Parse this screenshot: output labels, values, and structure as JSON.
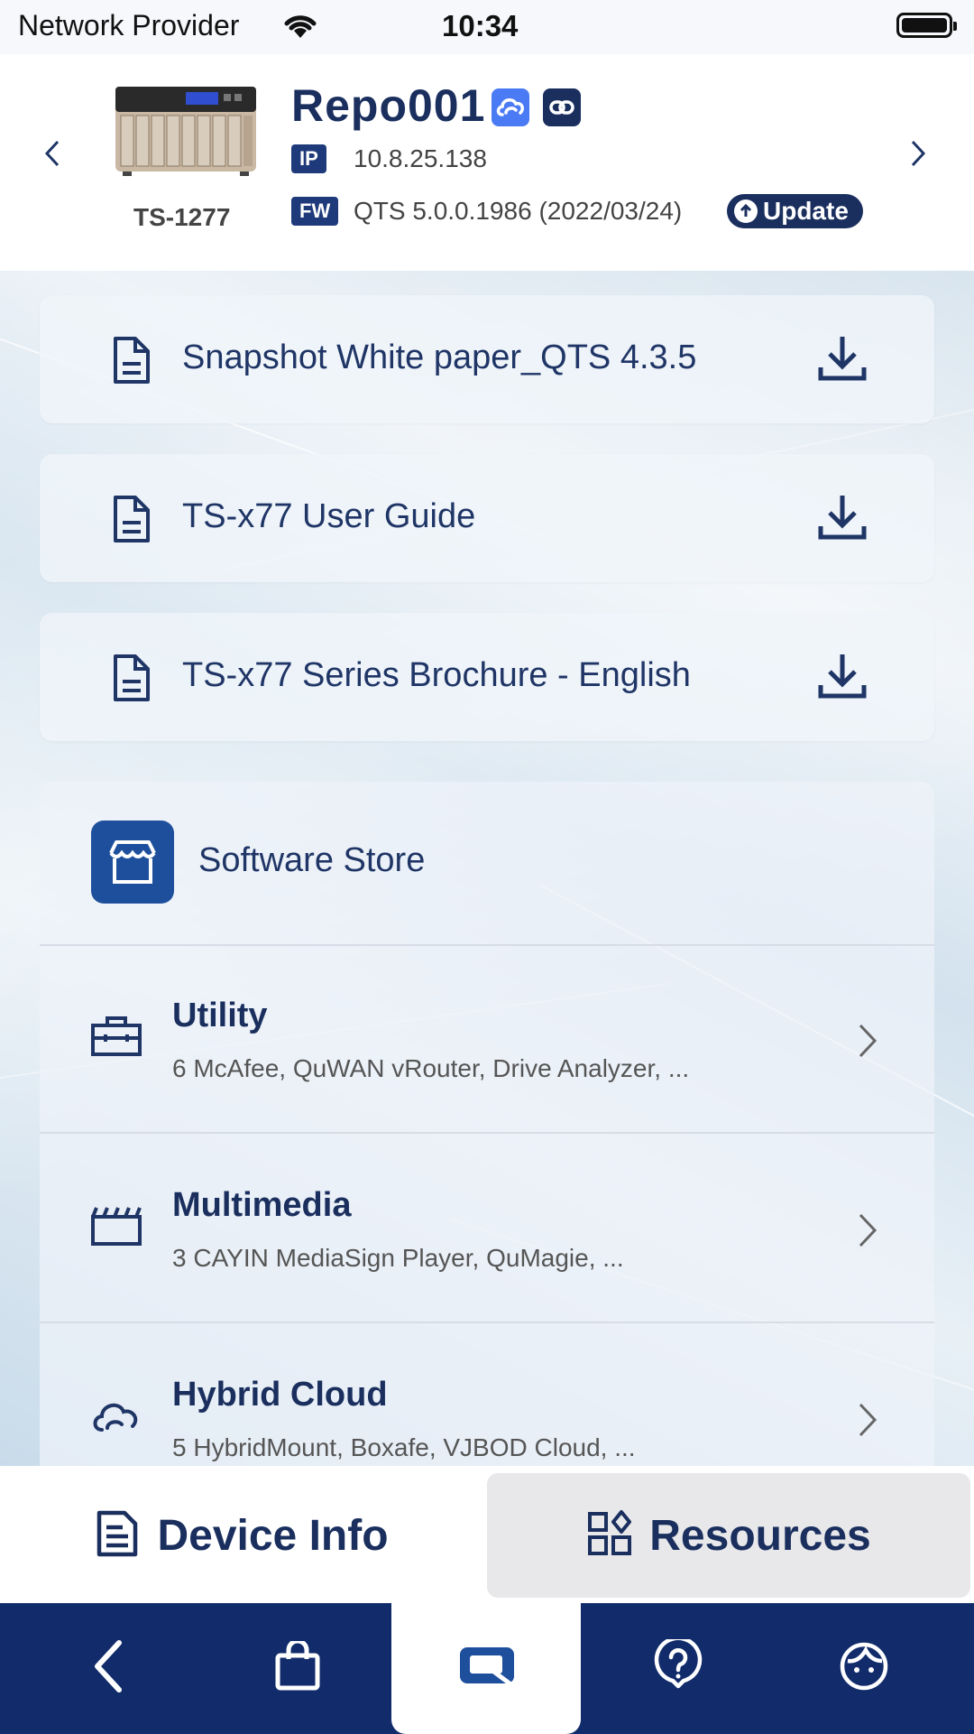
{
  "status_bar": {
    "carrier": "Network Provider",
    "time": "10:34"
  },
  "device": {
    "model": "TS-1277",
    "name": "Repo001",
    "ip_tag": "IP",
    "ip": "10.8.25.138",
    "fw_tag": "FW",
    "firmware": "QTS 5.0.0.1986 (2022/03/24)",
    "update_label": "Update"
  },
  "documents": [
    {
      "title": "Snapshot White paper_QTS 4.3.5"
    },
    {
      "title": "TS-x77 User Guide"
    },
    {
      "title": "TS-x77 Series Brochure - English"
    }
  ],
  "store": {
    "title": "Software Store",
    "categories": [
      {
        "name": "Utility",
        "desc": "6 McAfee, QuWAN vRouter, Drive Analyzer, ...",
        "icon": "toolbox-icon"
      },
      {
        "name": "Multimedia",
        "desc": "3 CAYIN MediaSign Player, QuMagie, ...",
        "icon": "clapperboard-icon"
      },
      {
        "name": "Hybrid Cloud",
        "desc": "5 HybridMount, Boxafe, VJBOD Cloud, ...",
        "icon": "cloud-icon"
      }
    ]
  },
  "segments": {
    "device_info": "Device Info",
    "resources": "Resources",
    "active": "resources"
  },
  "bottom_nav": [
    "back-icon",
    "shopping-bag-icon",
    "device-icon",
    "help-icon",
    "profile-icon"
  ],
  "colors": {
    "primary": "#1a2f5e",
    "accent_blue": "#4a7bf5",
    "bottom_bar": "#122c6b",
    "store_logo": "#1e4f9c"
  }
}
